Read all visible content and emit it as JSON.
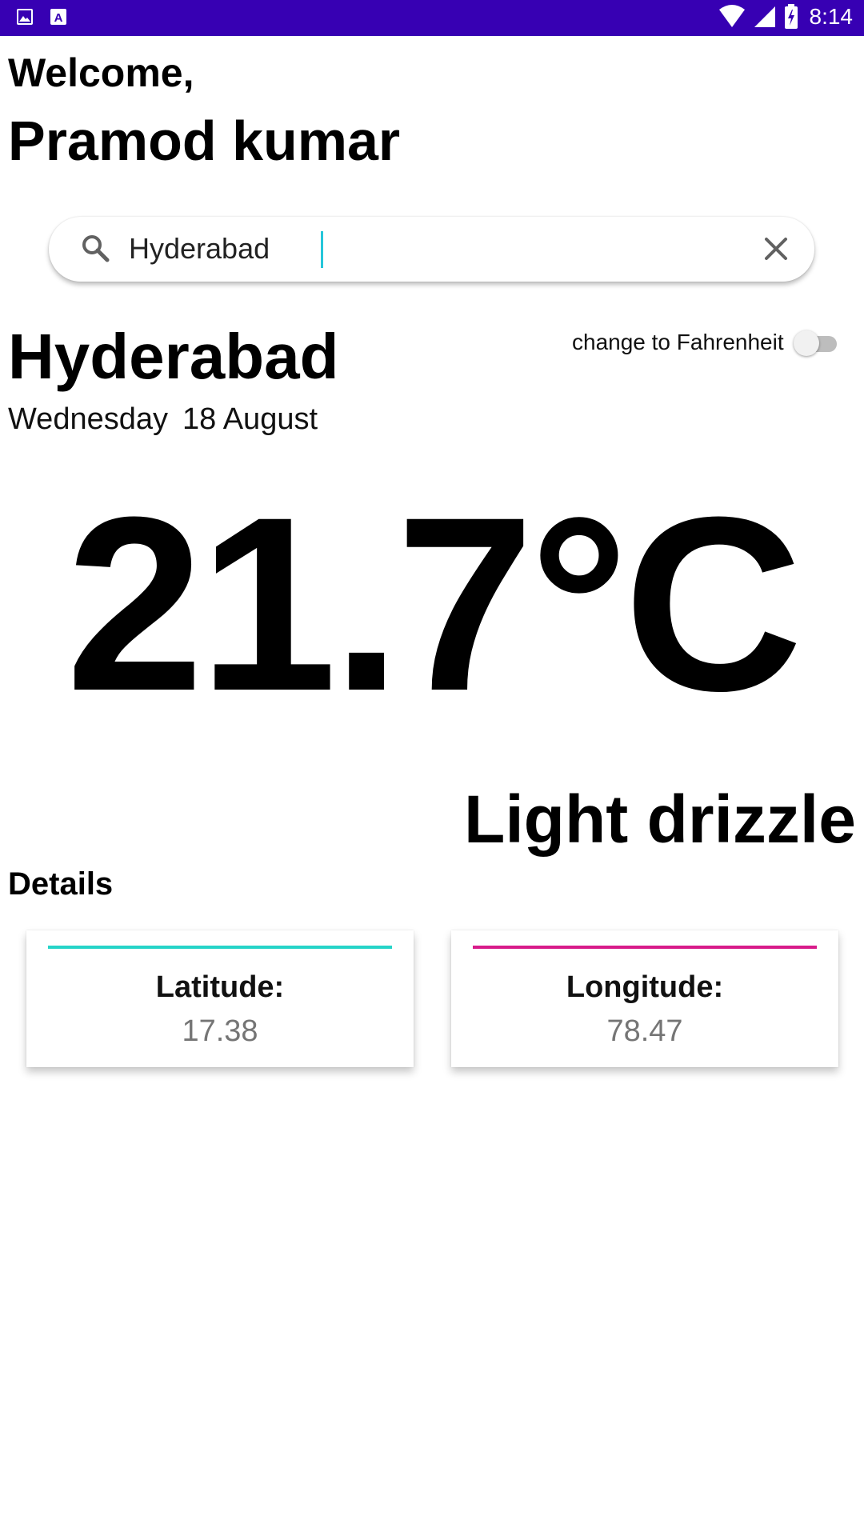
{
  "status_bar": {
    "time": "8:14",
    "color": "#3700b3",
    "icons_left": [
      "gallery-icon",
      "text-a-icon"
    ],
    "icons_right": [
      "wifi-icon",
      "signal-icon",
      "battery-icon"
    ]
  },
  "greeting": {
    "welcome": "Welcome,",
    "name": "Pramod kumar"
  },
  "search": {
    "value": "Hyderabad",
    "placeholder": ""
  },
  "weather": {
    "city": "Hyderabad",
    "day": "Wednesday",
    "date": "18 August",
    "unit_toggle_label": "change to Fahrenheit",
    "unit_toggle_on": false,
    "temperature": "21.7°C",
    "condition": "Light drizzle"
  },
  "details": {
    "heading": "Details",
    "cards": [
      {
        "label": "Latitude:",
        "value": "17.38",
        "accent_color": "#26d4c8"
      },
      {
        "label": "Longitude:",
        "value": "78.47",
        "accent_color": "#d81b8a"
      }
    ]
  }
}
